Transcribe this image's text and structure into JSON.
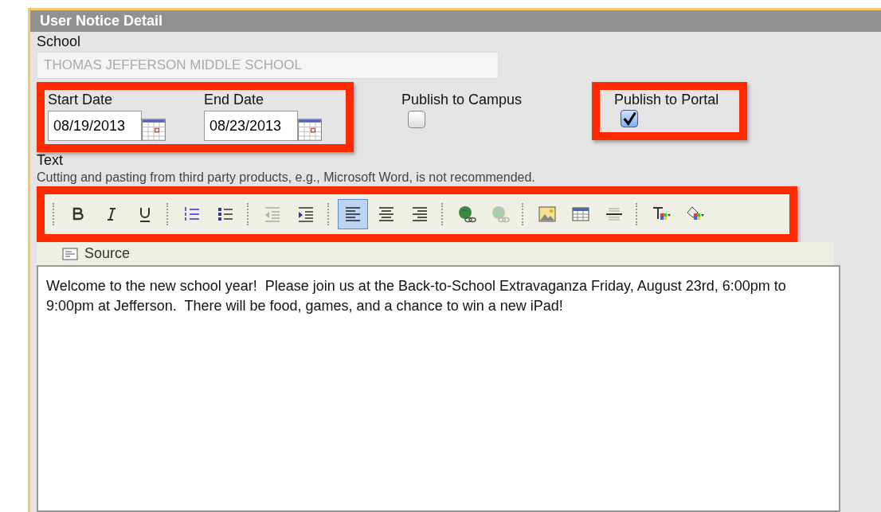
{
  "panel": {
    "title": "User Notice Detail"
  },
  "school": {
    "label": "School",
    "value": "THOMAS JEFFERSON MIDDLE SCHOOL",
    "disabled": true
  },
  "start_date": {
    "label": "Start Date",
    "value": "08/19/2013"
  },
  "end_date": {
    "label": "End Date",
    "value": "08/23/2013"
  },
  "publish_campus": {
    "label": "Publish to Campus",
    "checked": false
  },
  "publish_portal": {
    "label": "Publish to Portal",
    "checked": true
  },
  "text_label": "Text",
  "notice": "Cutting and pasting from third party products, e.g., Microsoft Word, is not recommended.",
  "toolbar": {
    "groups": [
      [
        {
          "kind": "bold",
          "selected": false,
          "disabled": false
        },
        {
          "kind": "italic",
          "selected": false,
          "disabled": false
        },
        {
          "kind": "underline",
          "selected": false,
          "disabled": false
        }
      ],
      [
        {
          "kind": "ordered-list",
          "selected": false,
          "disabled": false
        },
        {
          "kind": "bullet-list",
          "selected": false,
          "disabled": false
        }
      ],
      [
        {
          "kind": "outdent",
          "selected": false,
          "disabled": true
        },
        {
          "kind": "indent",
          "selected": false,
          "disabled": false
        }
      ],
      [
        {
          "kind": "align-left",
          "selected": true,
          "disabled": false
        },
        {
          "kind": "align-center",
          "selected": false,
          "disabled": false
        },
        {
          "kind": "align-right",
          "selected": false,
          "disabled": false
        }
      ],
      [
        {
          "kind": "link",
          "selected": false,
          "disabled": false
        },
        {
          "kind": "unlink",
          "selected": false,
          "disabled": true
        }
      ],
      [
        {
          "kind": "image",
          "selected": false,
          "disabled": false
        },
        {
          "kind": "table",
          "selected": false,
          "disabled": false
        },
        {
          "kind": "rule",
          "selected": false,
          "disabled": false
        }
      ],
      [
        {
          "kind": "text-color",
          "selected": false,
          "disabled": false
        },
        {
          "kind": "background-color",
          "selected": false,
          "disabled": false
        }
      ]
    ]
  },
  "source_button": "Source",
  "editor_text": "Welcome to the new school year!  Please join us at the Back-to-School Extravaganza Friday, August 23rd, 6:00pm to 9:00pm at Jefferson.  There will be food, games, and a chance to win a new iPad!"
}
